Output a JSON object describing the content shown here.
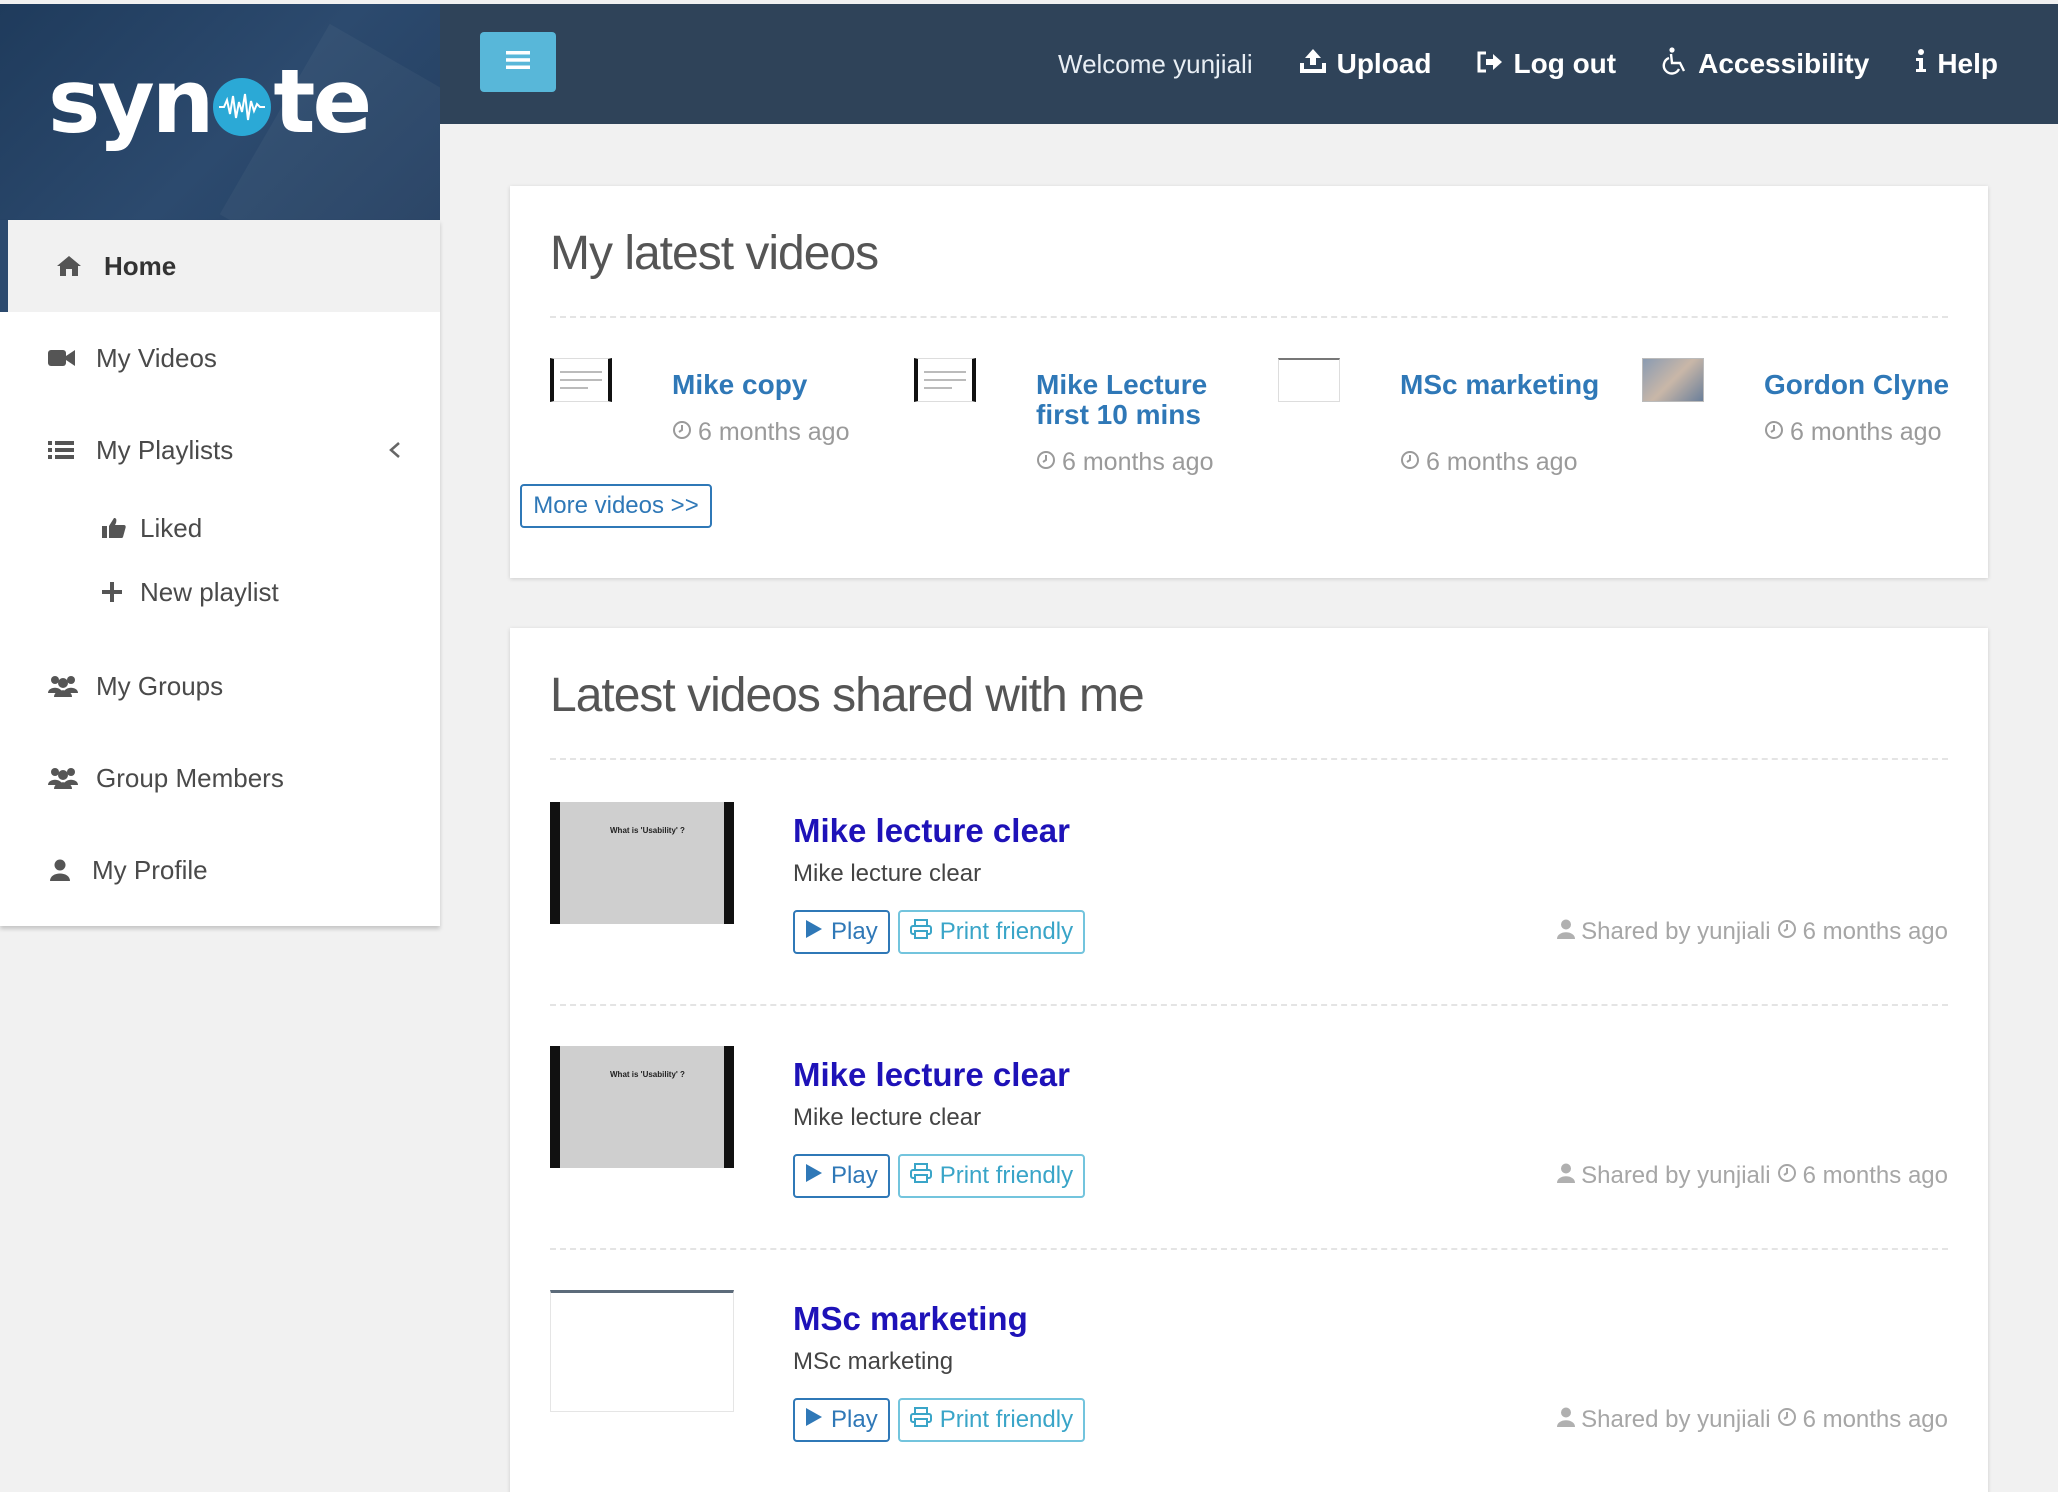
{
  "brand": {
    "logo_text_left": "syn",
    "logo_text_right": "te"
  },
  "sidebar": {
    "items": [
      {
        "label": "Home",
        "icon": "home-icon"
      },
      {
        "label": "My Videos",
        "icon": "video-camera-icon"
      },
      {
        "label": "My Playlists",
        "icon": "list-icon"
      },
      {
        "label": "My Groups",
        "icon": "users-icon"
      },
      {
        "label": "Group Members",
        "icon": "users-icon"
      },
      {
        "label": "My Profile",
        "icon": "user-icon"
      }
    ],
    "subitems": [
      {
        "label": "Liked",
        "icon": "thumbs-up-icon"
      },
      {
        "label": "New playlist",
        "icon": "plus-icon"
      }
    ]
  },
  "topbar": {
    "welcome": "Welcome yunjiali",
    "upload": "Upload",
    "logout": "Log out",
    "accessibility": "Accessibility",
    "help": "Help"
  },
  "latest": {
    "title": "My latest videos",
    "videos": [
      {
        "title": "Mike copy",
        "ago": "6 months ago"
      },
      {
        "title": "Mike Lecture first 10 mins",
        "ago": "6 months ago"
      },
      {
        "title": "MSc marketing",
        "ago": "6 months ago"
      },
      {
        "title": "Gordon Clyne",
        "ago": "6 months ago"
      }
    ],
    "more": "More videos >>"
  },
  "shared": {
    "title": "Latest videos shared with me",
    "thumb_text": "What is 'Usability' ?",
    "play": "Play",
    "print": "Print friendly",
    "items": [
      {
        "title": "Mike lecture clear",
        "desc": "Mike lecture clear",
        "shared_by": "Shared by yunjiali",
        "ago": "6 months ago"
      },
      {
        "title": "Mike lecture clear",
        "desc": "Mike lecture clear",
        "shared_by": "Shared by yunjiali",
        "ago": "6 months ago"
      },
      {
        "title": "MSc marketing",
        "desc": "MSc marketing",
        "shared_by": "Shared by yunjiali",
        "ago": "6 months ago"
      }
    ]
  },
  "colors": {
    "topbar": "#2f4359",
    "accent": "#58b7d9",
    "link": "#2f78b7",
    "shared_title": "#1e12b8"
  }
}
